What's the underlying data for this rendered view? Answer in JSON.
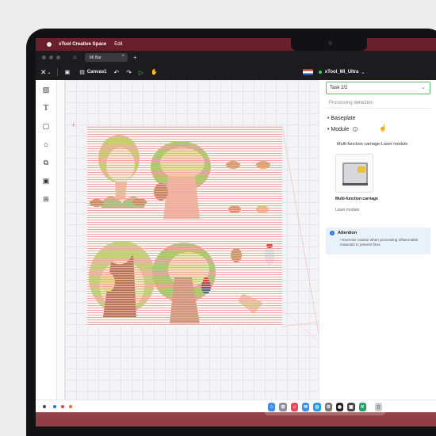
{
  "menubar": {
    "app_name": "xTool Creative Space",
    "edit_menu": "Edit"
  },
  "tabs": {
    "active_tab": "MI Bar",
    "new_tab_symbol": "+",
    "close_symbol": "×"
  },
  "toolbar": {
    "canvas_name": "Canvas1",
    "device_name": "xTool_MI_Ultra",
    "device_status_color": "#39d05f",
    "icons": [
      "close-icon",
      "chevron-down-icon",
      "save-icon",
      "undo-icon",
      "redo-icon",
      "play-icon",
      "hand-icon",
      "flag-icon"
    ]
  },
  "left_tools": [
    "image-icon",
    "text-icon",
    "shape-icon",
    "tag-icon",
    "layers-icon",
    "ai-image-icon",
    "apps-icon"
  ],
  "right_panel": {
    "task_label": "Task 2/2",
    "section_title": "Processing detection",
    "items": [
      {
        "bullet": "•",
        "label": "Baseplate"
      },
      {
        "bullet": "•",
        "label": "Module"
      }
    ],
    "module_heading": "Multi-function carriage-Laser module",
    "module_card": {
      "name": "Multi-function carriage",
      "sub": "Laser module"
    },
    "attention": {
      "title": "Attention",
      "text": "• Exercise caution when processing inflammable materials to prevent fires."
    }
  },
  "dock": {
    "icons": [
      "finder-icon",
      "launchpad-icon",
      "music-icon",
      "mail-icon",
      "safari-icon",
      "settings-icon",
      "xtool-icon",
      "screenshot-icon",
      "excel-icon",
      "trash-icon"
    ]
  },
  "colors": {
    "accent_green": "#5fbf73",
    "info_blue": "#2f6fd6",
    "wallpaper": "#6a1f2d"
  }
}
